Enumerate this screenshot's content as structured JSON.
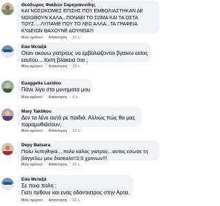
{
  "comments": [
    {
      "author": "Θεόδωρος Φαίδων Σαρηγιαννίδης",
      "lines": [
        "ΚΑΙ ΝΟΣΟΚΟΜΕΣ ΕΠΙΣΗΣ ΠΟΥ ΕΜΒΟΛΙΑΣΤΗΚΑΝ ΔΕ",
        "ΝΟΙΩΘΟΥΝ ΚΑΛΑ...ΠΟΝΑΕΙ ΤΟ ΣΩΜΑ ΚΑΙ ΤΑ ΟΣΤΑ",
        "ΤΟΥΣ.....ΛΥΠΑΜΕ ΠΟΥ ΤΟ ΛΕΩ ΑΛΛΑ...ΤΑ ΓΡΑΦΕΙΑ",
        "ΚΥΔΕΙΩΝ ΘΑΧΟΥΝΕ ΔΟΥΛΕΙΑ!!!"
      ],
      "like": "Μου αρέσει!",
      "reply": "Απάντηση",
      "time": "23 λ."
    },
    {
      "author": "Εύα Μεταξά",
      "lines": [
        "Οταν ακουω γιατρους να εμβολιαζονται βγαινω εκτος",
        "εαυτου....τοση βλακεια πια ;"
      ],
      "like": "Μου αρέσει!",
      "reply": "Απάντηση",
      "time": "22 λ."
    },
    {
      "author": "Euaggelia Lazidou",
      "lines": [
        "Πάνε λίγο στα μυνηματα μου"
      ],
      "like": "Μου αρέσει!",
      "reply": "Απάντηση",
      "time": "6 λ."
    },
    {
      "author": "Mary Taktikou",
      "lines": [
        "Δεν τα λένε αυτά ρε παιδιά. Αλλιώς πώς θα μας",
        "παραμυθιάσουν;"
      ],
      "like": "Μου αρέσει!",
      "reply": "Απάντηση",
      "time": "22 λ."
    },
    {
      "author": "Depy Batsara",
      "lines": [
        "Πολυ λυπηθηκα....πολυ καλος γιατρος...αυτος εσωσε τη",
        "βαγγελιω μου δασκαλε!!3,5 χρονων!!!"
      ],
      "like": "Μου αρέσει!",
      "reply": "Απάντηση",
      "time": "22 λ."
    },
    {
      "author": "Εύα Μεταξά",
      "lines": [
        "Σε ποια πολη ;",
        "Γιατι πεθανε και ενας οδοντιατρος στην Αρτα."
      ],
      "like": "Μου αρέσει!",
      "reply": "Απάντηση",
      "time": "22 λ."
    }
  ],
  "separator": "·",
  "colors": {
    "bubble": "#f0f2f5",
    "meta": "#65676b",
    "text": "#050505"
  },
  "avatars": [
    "avatar-photo-1",
    "avatar-photo-2",
    "avatar-photo-3",
    "avatar-photo-4",
    "avatar-photo-5",
    "avatar-photo-2"
  ]
}
